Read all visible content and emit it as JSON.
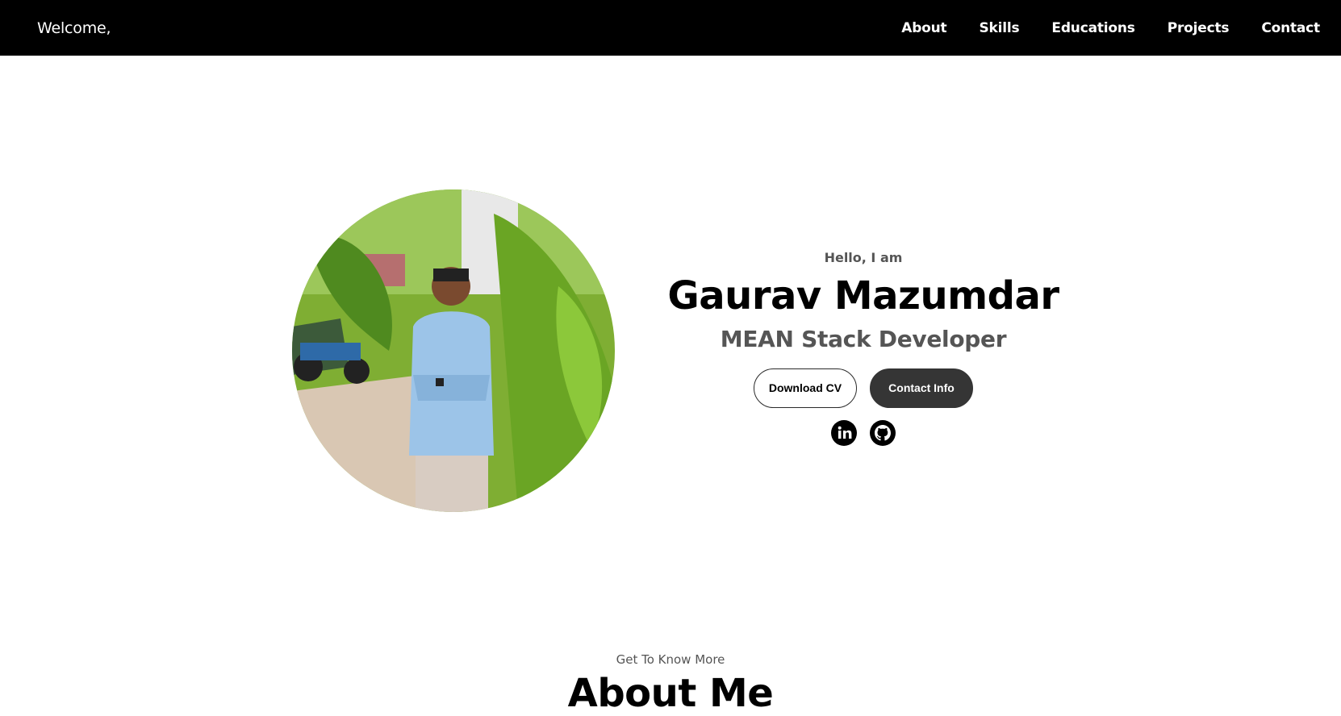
{
  "nav": {
    "logo": "Welcome,",
    "links": [
      "About",
      "Skills",
      "Educations",
      "Projects",
      "Contact"
    ]
  },
  "profile": {
    "greeting": "Hello, I am",
    "name": "Gaurav Mazumdar",
    "role": "MEAN Stack Developer",
    "photo_icon": "profile-photo"
  },
  "buttons": {
    "download_cv": "Download CV",
    "contact_info": "Contact Info"
  },
  "socials": [
    {
      "icon": "linkedin-icon"
    },
    {
      "icon": "github-icon"
    }
  ],
  "about": {
    "subtitle": "Get To Know More",
    "title": "About Me"
  },
  "colors": {
    "navbar": "#000000",
    "accent_button": "#353535",
    "muted_text": "#555555"
  }
}
